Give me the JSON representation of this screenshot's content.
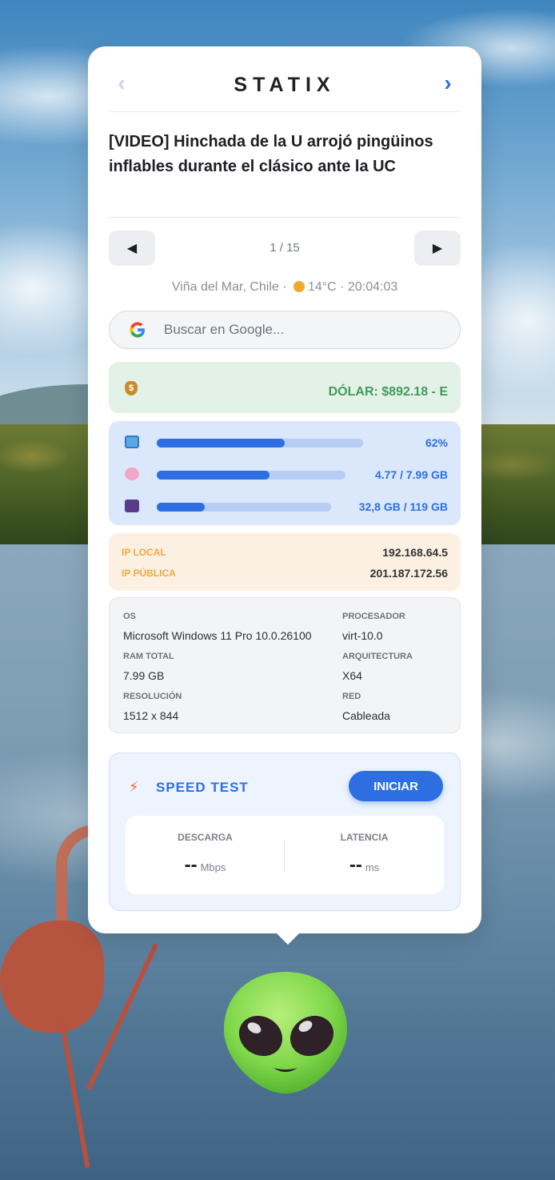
{
  "app": {
    "brand": "STATIX",
    "prev_icon": "chevron-left-icon",
    "next_icon": "chevron-right-icon"
  },
  "news": {
    "headline": "[VIDEO] Hinchada de la U arrojó pingüinos inflables durante el clásico ante la UC",
    "page": "1 / 15",
    "prev_label": "◀",
    "next_label": "▶"
  },
  "location": {
    "place": "Viña del Mar, Chile · ",
    "weather": "14°C · 20:04:03",
    "weather_icon": "sun-icon"
  },
  "search": {
    "placeholder": "Buscar en Google...",
    "icon": "google-icon"
  },
  "currency": {
    "label": "DÓLAR: $892.18 - E",
    "icon": "money-bag-icon"
  },
  "usage": {
    "cpu": {
      "value": "62%",
      "fraction": 0.62,
      "icon": "monitor-icon"
    },
    "ram": {
      "value": "4.77 / 7.99 GB",
      "fraction": 0.597,
      "icon": "brain-icon"
    },
    "disk": {
      "value": "32,8 GB / 119 GB",
      "fraction": 0.276,
      "icon": "floppy-disk-icon"
    }
  },
  "network": {
    "local_label": "IP LOCAL",
    "local_value": "192.168.64.5",
    "public_label": "IP PÚBLICA",
    "public_value": "201.187.172.56"
  },
  "system": {
    "os_label": "OS",
    "os_value": "Microsoft Windows 11 Pro 10.0.26100",
    "cpu_label": "PROCESADOR",
    "cpu_value": "virt-10.0",
    "ram_label": "RAM TOTAL",
    "ram_value": "7.99 GB",
    "arch_label": "ARQUITECTURA",
    "arch_value": "X64",
    "res_label": "RESOLUCIÓN",
    "res_value": "1512 x 844",
    "net_label": "RED",
    "net_value": "Cableada"
  },
  "speedtest": {
    "title": "SPEED TEST",
    "button": "INICIAR",
    "download_label": "DESCARGA",
    "download_value": "--",
    "download_unit": "Mbps",
    "latency_label": "LATENCIA",
    "latency_value": "--",
    "latency_unit": "ms",
    "icon": "lightning-icon"
  },
  "colors": {
    "accent": "#2d6fe2",
    "money": "#3f9b5d",
    "ip": "#f3a840"
  }
}
